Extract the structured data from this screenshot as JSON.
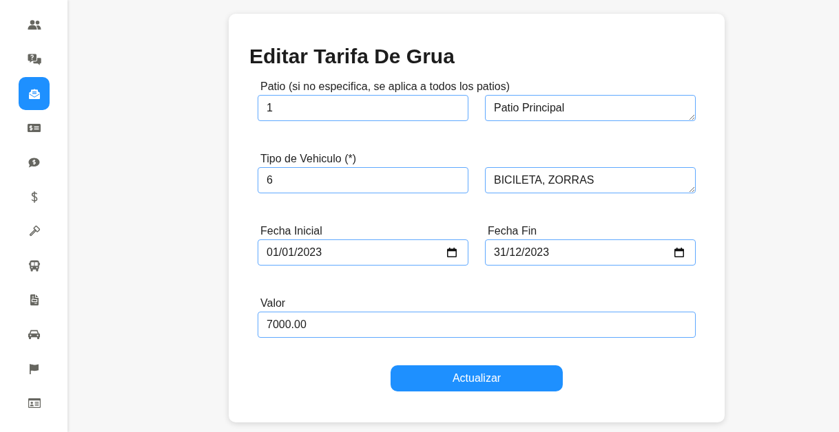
{
  "sidebar": {
    "items": [
      {
        "selected": false
      },
      {
        "selected": false
      },
      {
        "selected": true
      },
      {
        "selected": false
      },
      {
        "selected": false
      },
      {
        "selected": false
      },
      {
        "selected": false
      },
      {
        "selected": false
      },
      {
        "selected": false
      },
      {
        "selected": false
      },
      {
        "selected": false
      },
      {
        "selected": false
      }
    ]
  },
  "form": {
    "title": "Editar Tarifa De Grua",
    "rows": [
      {
        "label": "Patio (si no especifica, se aplica a todos los patios)",
        "fields": [
          {
            "kind": "text",
            "value": "1"
          },
          {
            "kind": "textarea",
            "value": "Patio Principal"
          }
        ]
      },
      {
        "label": "Tipo de Vehiculo (*)",
        "fields": [
          {
            "kind": "text",
            "value": "6"
          },
          {
            "kind": "textarea",
            "value": "BICILETA, ZORRAS"
          }
        ]
      },
      {
        "fields": [
          {
            "label": "Fecha Inicial",
            "kind": "date",
            "value": "01/01/2023"
          },
          {
            "label": "Fecha Fin",
            "kind": "date",
            "value": "31/12/2023"
          }
        ]
      },
      {
        "label": "Valor",
        "fields": [
          {
            "kind": "text",
            "value": "7000.00"
          }
        ]
      }
    ],
    "submit": "Actualizar"
  }
}
